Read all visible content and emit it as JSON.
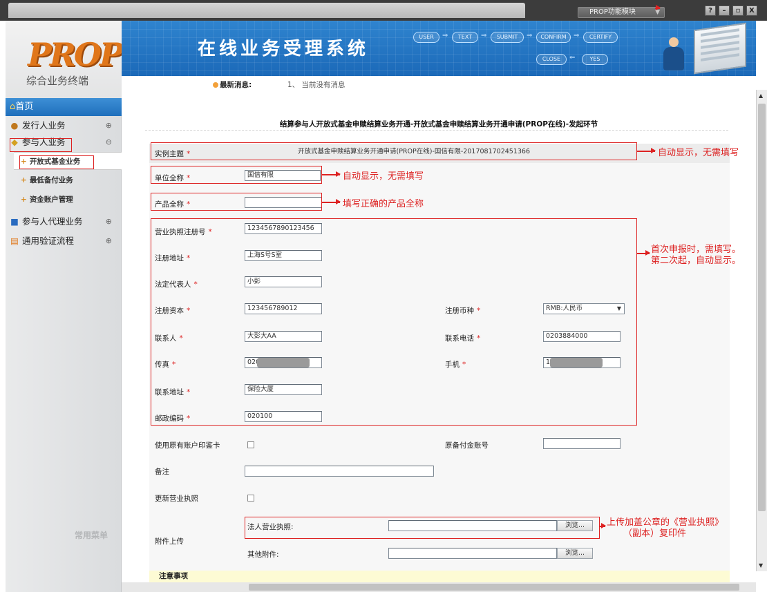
{
  "window": {
    "module_select": "PROP功能模块",
    "buttons": [
      "?",
      "–",
      "▫",
      "X"
    ]
  },
  "sidebar": {
    "logo_text": "PROP",
    "logo_subtitle": "综合业务终端",
    "home": "首页",
    "items": [
      {
        "label": "发行人业务",
        "toggle": "⊕"
      },
      {
        "label": "参与人业务",
        "toggle": "⊖"
      },
      {
        "label": "参与人代理业务",
        "toggle": "⊕"
      },
      {
        "label": "通用验证流程",
        "toggle": "⊕"
      }
    ],
    "subitems": [
      "开放式基金业务",
      "最低备付业务",
      "资金账户管理"
    ],
    "common_menu": "常用菜单"
  },
  "banner": {
    "title": "在线业务受理系统",
    "flow_steps": [
      "USER",
      "TEXT",
      "SUBMIT",
      "CONFIRM",
      "CERTIFY",
      "CLOSE",
      "YES"
    ]
  },
  "news": {
    "label": "最新消息:",
    "text": "1、  当前没有消息"
  },
  "page": {
    "title": "结算参与人开放式基金申赎结算业务开通-开放式基金申赎结算业务开通申请(PROP在线)-发起环节"
  },
  "form": {
    "topic_label": "实例主题",
    "topic_value": "开放式基金申赎结算业务开通申请(PROP在线)-国信有限-2017081702451366",
    "org_name_label": "单位全称",
    "org_name_value": "国信有限",
    "product_name_label": "产品全称",
    "product_name_value": "",
    "license_no_label": "营业执照注册号",
    "license_no_value": "1234567890123456",
    "reg_address_label": "注册地址",
    "reg_address_value": "上海S号S室",
    "legal_rep_label": "法定代表人",
    "legal_rep_value": "小彭",
    "reg_capital_label": "注册资本",
    "reg_capital_value": "123456789012",
    "currency_label": "注册币种",
    "currency_value": "RMB:人民币",
    "contact_label": "联系人",
    "contact_value": "大彭大AA",
    "phone_label": "联系电话",
    "phone_value": "0203884000",
    "fax_label": "传真",
    "fax_value": "020",
    "mobile_label": "手机",
    "mobile_value": "1",
    "contact_address_label": "联系地址",
    "contact_address_value": "保险大厦",
    "postcode_label": "邮政编码",
    "postcode_value": "020100",
    "use_seal_card_label": "使用原有账户印鉴卡",
    "orig_account_label": "原备付金账号",
    "orig_account_value": "",
    "remark_label": "备注",
    "remark_value": "",
    "update_license_label": "更新营业执照",
    "attachment_label": "附件上传",
    "legal_license_label": "法人营业执照:",
    "other_attachment_label": "其他附件:",
    "browse_label": "浏览...",
    "notice_label": "注意事项"
  },
  "annotations": {
    "auto_display_1": "自动显示，无需填写",
    "auto_display_2": "自动显示，无需填写",
    "fill_product": "填写正确的产品全称",
    "first_time_line1": "首次申报时，需填写。",
    "first_time_line2": "第二次起，自动显示。",
    "upload_line1": "上传加盖公章的《营业执照》",
    "upload_line2": "（副本）复印件"
  },
  "colors": {
    "banner_blue": "#2f84cf",
    "home_blue": "#1f6fbc",
    "annotation_red": "#dd2222",
    "logo_orange": "#e0761a",
    "required_red": "#dd2222"
  }
}
